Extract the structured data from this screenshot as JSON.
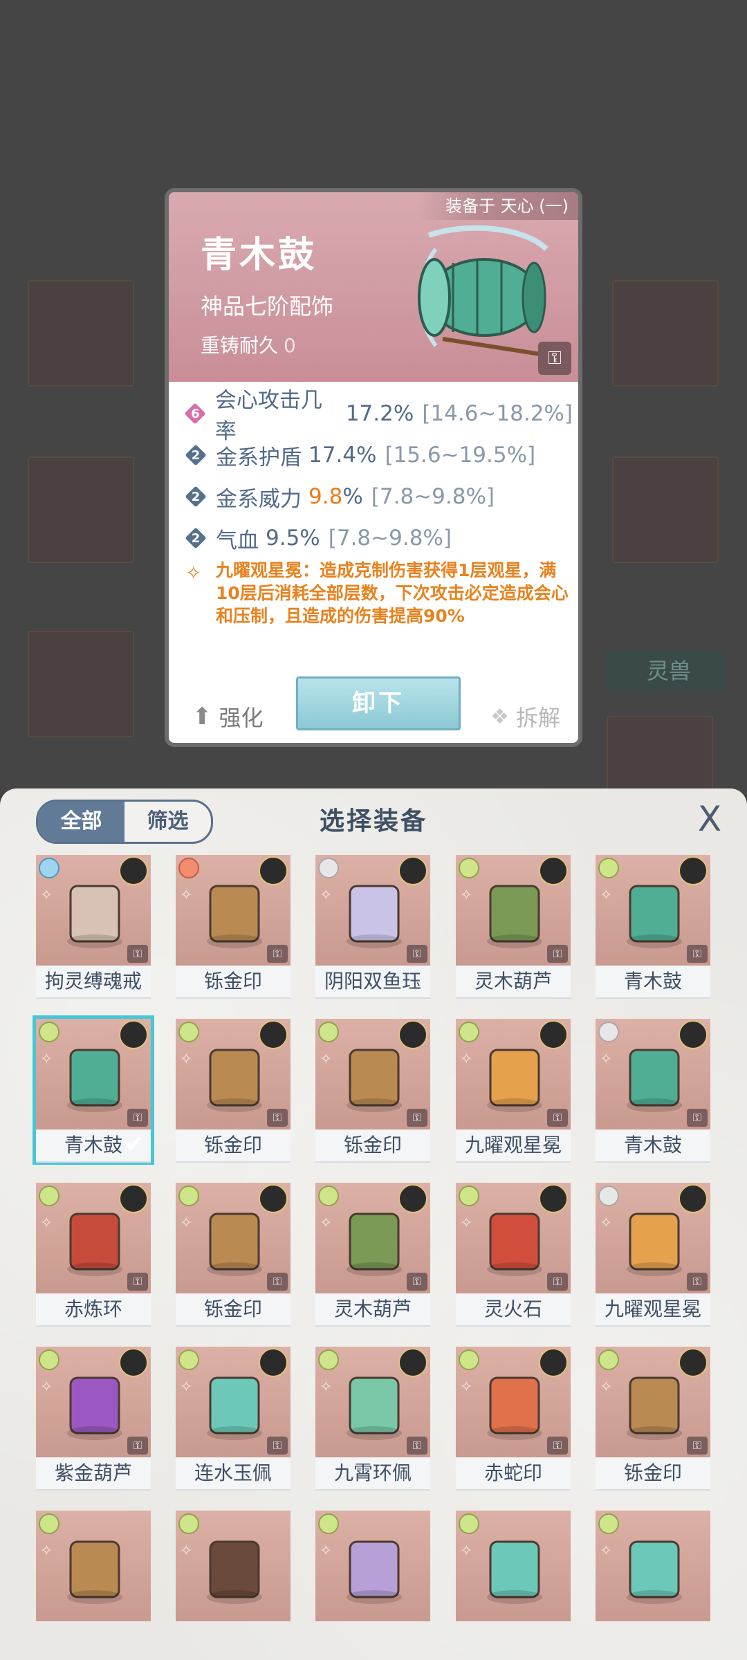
{
  "detail": {
    "equipped_by": "装备于 天心 (一)",
    "name": "青木鼓",
    "grade": "神品七阶配饰",
    "durability_label": "重铸耐久",
    "durability_value": "0",
    "stats": [
      {
        "level": "6",
        "label": "会心攻击几率",
        "value": "17.2%",
        "range": "[14.6~18.2%]"
      },
      {
        "level": "2",
        "label": "金系护盾",
        "value": "17.4%",
        "range": "[15.6~19.5%]"
      },
      {
        "level": "2",
        "label": "金系威力",
        "value_hi": "9.8",
        "value_suffix": "%",
        "range": "[7.8~9.8%]"
      },
      {
        "level": "2",
        "label": "气血",
        "value": "9.5%",
        "range": "[7.8~9.8%]"
      }
    ],
    "effect": "九曜观星冕：造成克制伤害获得1层观星，满10层后消耗全部层数，下次攻击必定造成会心和压制，且造成的伤害提高90%",
    "strengthen_label": "强化",
    "unequip_label": "卸下",
    "dismantle_label": "拆解"
  },
  "background": {
    "tag_label": "灵兽"
  },
  "panel": {
    "tab_all": "全部",
    "tab_filter": "筛选",
    "title": "选择装备",
    "close": "X"
  },
  "items": [
    {
      "name": "拘灵缚魂戒"
    },
    {
      "name": "铄金印"
    },
    {
      "name": "阴阳双鱼珏"
    },
    {
      "name": "灵木葫芦"
    },
    {
      "name": "青木鼓"
    },
    {
      "name": "青木鼓",
      "selected": true
    },
    {
      "name": "铄金印"
    },
    {
      "name": "铄金印"
    },
    {
      "name": "九曜观星冕"
    },
    {
      "name": "青木鼓"
    },
    {
      "name": "赤炼环"
    },
    {
      "name": "铄金印"
    },
    {
      "name": "灵木葫芦"
    },
    {
      "name": "灵火石"
    },
    {
      "name": "九曜观星冕"
    },
    {
      "name": "紫金葫芦"
    },
    {
      "name": "连水玉佩"
    },
    {
      "name": "九霄环佩"
    },
    {
      "name": "赤蛇印"
    },
    {
      "name": "铄金印"
    },
    {
      "name": ""
    },
    {
      "name": ""
    },
    {
      "name": ""
    },
    {
      "name": ""
    },
    {
      "name": ""
    }
  ],
  "colors": {
    "accent": "#45c7d8",
    "stat_text": "#526a8a",
    "highlight": "#f07a18"
  }
}
